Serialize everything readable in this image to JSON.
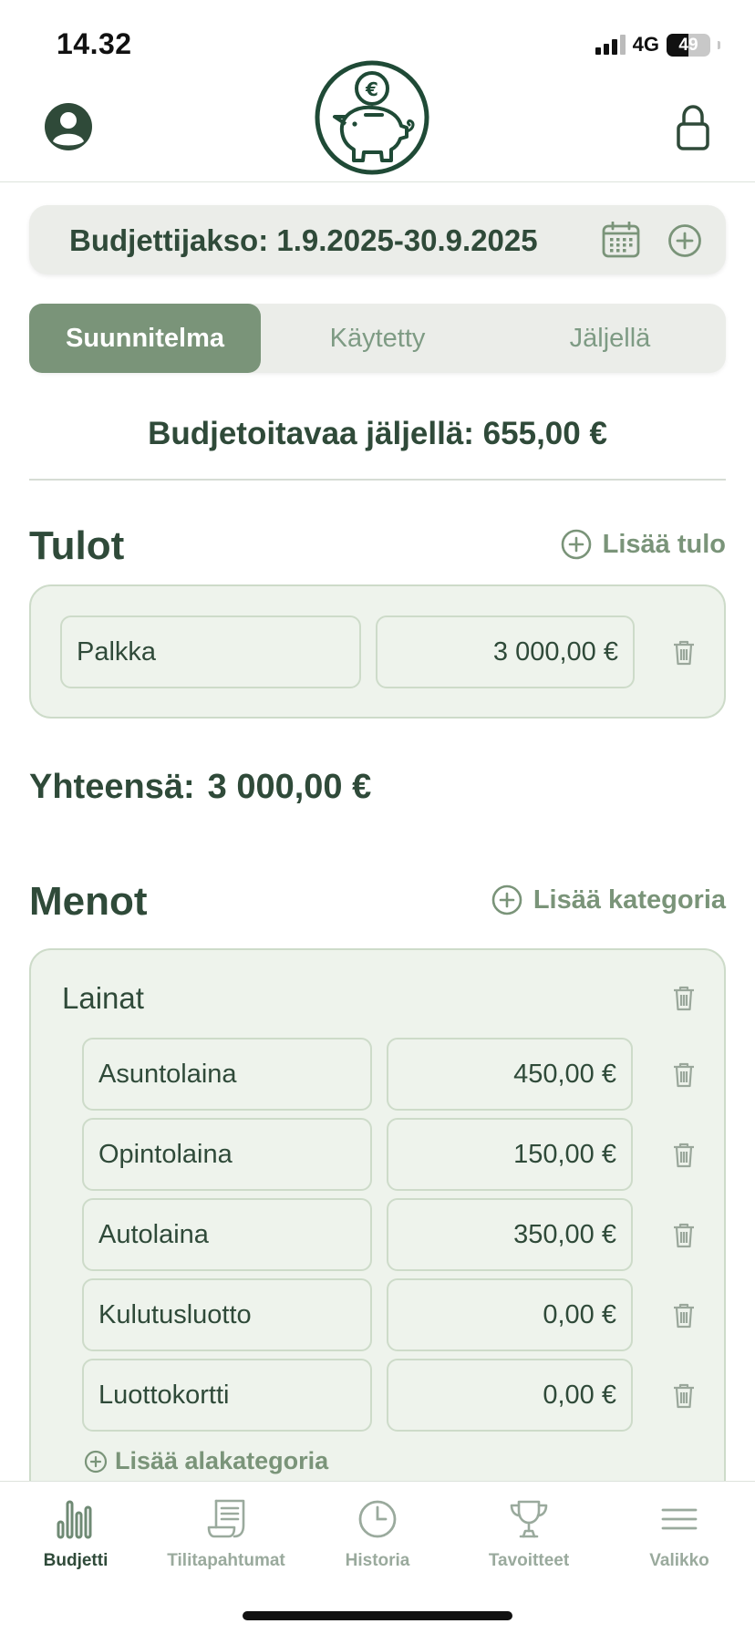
{
  "status_bar": {
    "time": "14.32",
    "network": "4G",
    "battery": "49",
    "battery_level": 0.49
  },
  "period": {
    "label": "Budjettijakso: 1.9.2025-30.9.2025"
  },
  "segments": [
    {
      "label": "Suunnitelma",
      "active": true
    },
    {
      "label": "Käytetty",
      "active": false
    },
    {
      "label": "Jäljellä",
      "active": false
    }
  ],
  "remaining": {
    "label": "Budjetoitavaa jäljellä: 655,00 €"
  },
  "income": {
    "title": "Tulot",
    "add_label": "Lisää tulo",
    "items": [
      {
        "name": "Palkka",
        "amount": "3 000,00 €"
      }
    ],
    "total_label": "Yhteensä:",
    "total_value": "3 000,00 €"
  },
  "expenses": {
    "title": "Menot",
    "add_label": "Lisää kategoria",
    "categories": [
      {
        "name": "Lainat",
        "items": [
          {
            "name": "Asuntolaina",
            "amount": "450,00 €"
          },
          {
            "name": "Opintolaina",
            "amount": "150,00 €"
          },
          {
            "name": "Autolaina",
            "amount": "350,00 €"
          },
          {
            "name": "Kulutusluotto",
            "amount": "0,00 €"
          },
          {
            "name": "Luottokortti",
            "amount": "0,00 €"
          }
        ],
        "add_sub_label": "Lisää alakategoria"
      }
    ]
  },
  "tabbar": {
    "items": [
      {
        "label": "Budjetti",
        "icon": "bar-chart-icon",
        "active": true
      },
      {
        "label": "Tilitapahtumat",
        "icon": "receipt-icon",
        "active": false
      },
      {
        "label": "Historia",
        "icon": "clock-icon",
        "active": false
      },
      {
        "label": "Tavoitteet",
        "icon": "trophy-icon",
        "active": false
      },
      {
        "label": "Valikko",
        "icon": "menu-icon",
        "active": false
      }
    ]
  },
  "colors": {
    "accent": "#7a9479",
    "text": "#2f4a39",
    "card_bg": "#eef3ec",
    "card_border": "#cddbc9"
  }
}
